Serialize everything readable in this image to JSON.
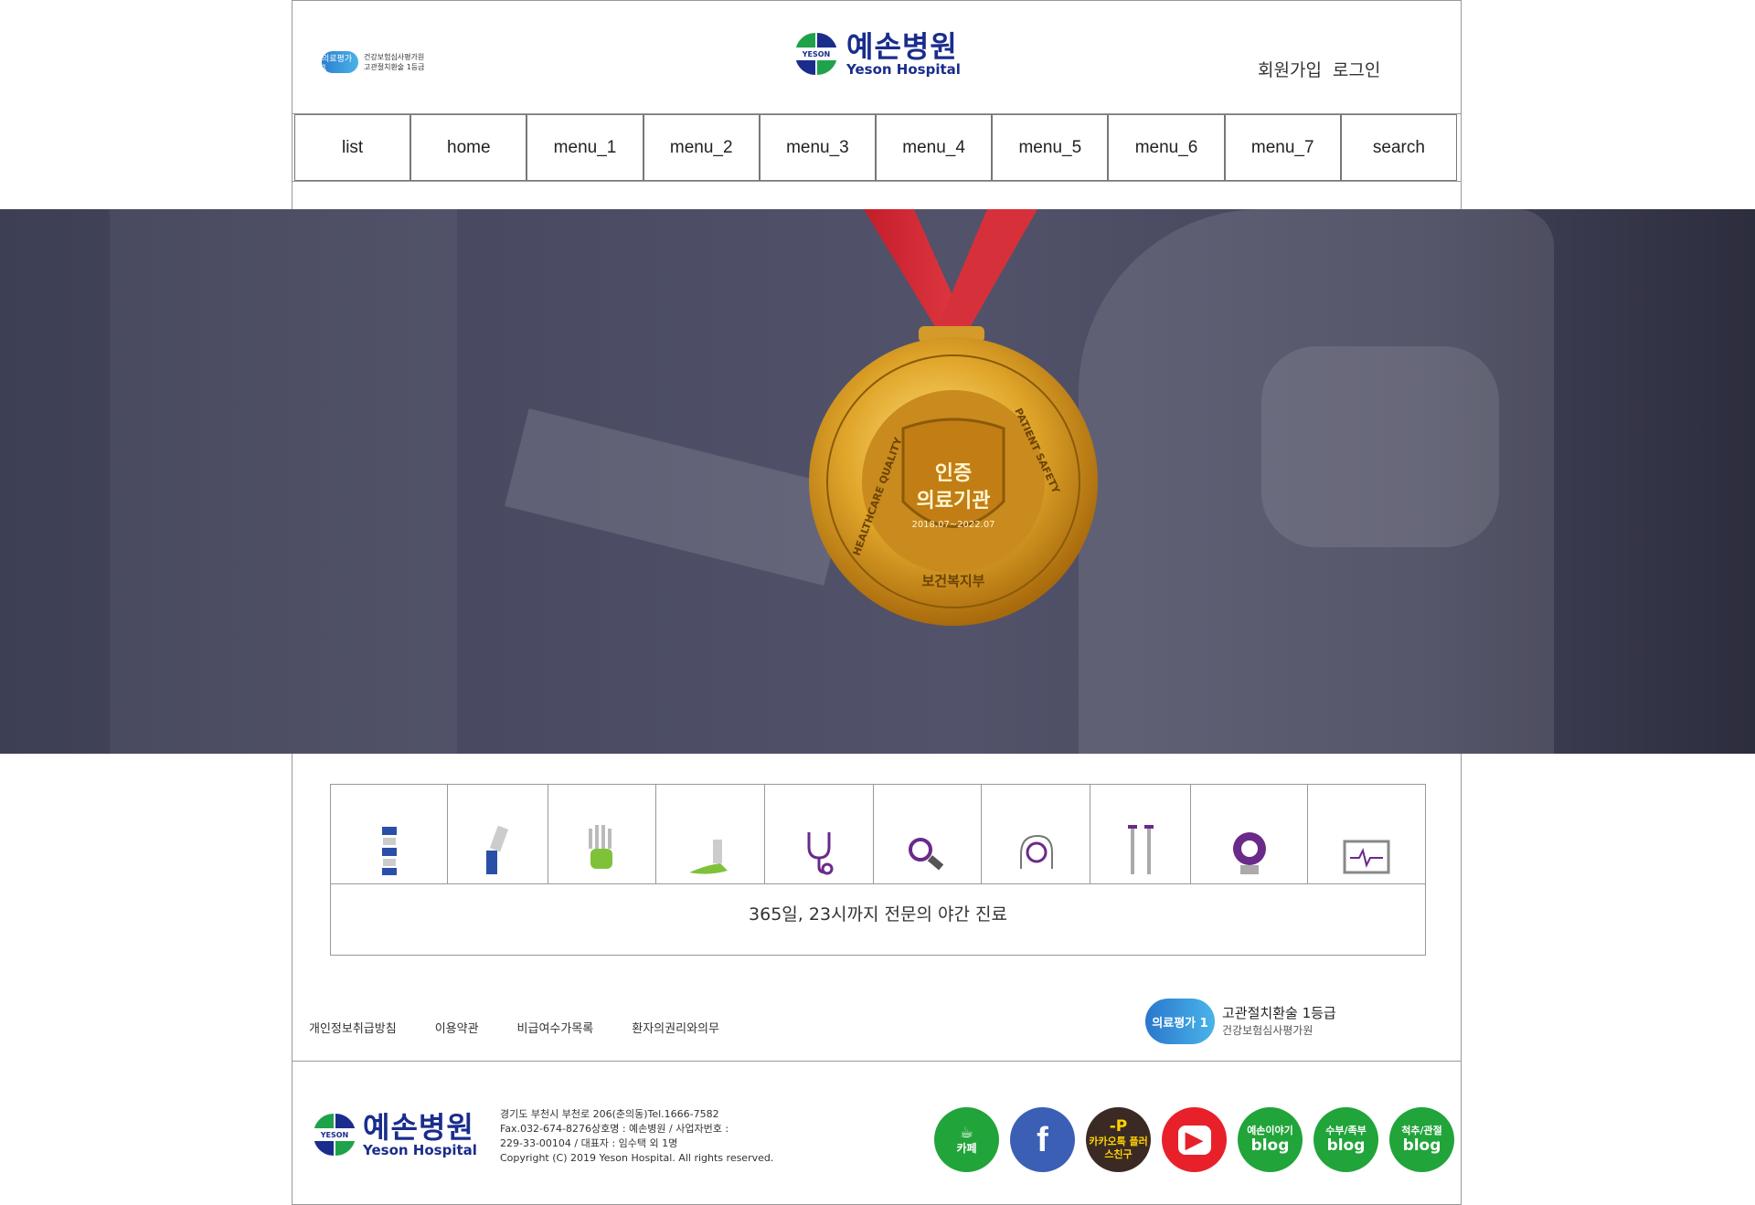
{
  "header": {
    "cert_badge": "의료평가 1",
    "cert_line1": "건강보험심사평가원",
    "cert_line2": "고관절치환술 1등급",
    "logo_band": "YESON",
    "logo_ko": "예손병원",
    "logo_en": "Yeson Hospital",
    "signup": "회원가입",
    "login": "로그인"
  },
  "nav": [
    {
      "label": "list"
    },
    {
      "label": "home"
    },
    {
      "label": "menu_1"
    },
    {
      "label": "menu_2"
    },
    {
      "label": "menu_3"
    },
    {
      "label": "menu_4"
    },
    {
      "label": "menu_5"
    },
    {
      "label": "menu_6"
    },
    {
      "label": "menu_7"
    },
    {
      "label": "search"
    }
  ],
  "hero": {
    "medal_title1": "인증",
    "medal_title2": "의료기관",
    "medal_dates": "2018.07~2022.07",
    "medal_ring_left": "HEALTHCARE QUALITY",
    "medal_ring_right": "PATIENT SAFETY",
    "medal_ring_bottom": "보건복지부"
  },
  "services": {
    "icons": [
      "spine-icon",
      "knee-icon",
      "hand-icon",
      "foot-icon",
      "stethoscope-icon",
      "magnifier-icon",
      "brain-icon",
      "crutches-icon",
      "mri-icon",
      "monitor-icon"
    ],
    "caption": "365일, 23시까지 전문의 야간 진료"
  },
  "footer": {
    "links": [
      "개인정보취급방침",
      "이용약관",
      "비급여수가목록",
      "환자의권리와의무"
    ],
    "cert_badge": "의료평가 1",
    "cert_title": "고관절치환술 1등급",
    "cert_sub": "건강보험심사평가원",
    "address_lines": [
      "경기도 부천시 부천로 206(춘의동)Tel.1666-7582",
      "Fax.032-674-8276상호명 : 예손병원 / 사업자번호 :",
      "229-33-00104 / 대표자 : 임수택 외 1명",
      "Copyright (C) 2019 Yeson Hospital. All rights reserved."
    ],
    "sns": [
      {
        "name": "cafe",
        "top": "☕",
        "bottom": "카페",
        "color": "#21a43a"
      },
      {
        "name": "facebook",
        "top": "f",
        "bottom": "",
        "color": "#3b5fb5"
      },
      {
        "name": "kakao",
        "top": "-P",
        "bottom": "카카오톡 플러스친구",
        "color": "#3b2a24"
      },
      {
        "name": "youtube",
        "top": "▶",
        "bottom": "",
        "color": "#e8202a"
      },
      {
        "name": "blog1",
        "top": "예손이야기",
        "bottom": "blog",
        "color": "#21a43a"
      },
      {
        "name": "blog2",
        "top": "수부/족부",
        "bottom": "blog",
        "color": "#21a43a"
      },
      {
        "name": "blog3",
        "top": "척추/관절",
        "bottom": "blog",
        "color": "#21a43a"
      }
    ]
  }
}
